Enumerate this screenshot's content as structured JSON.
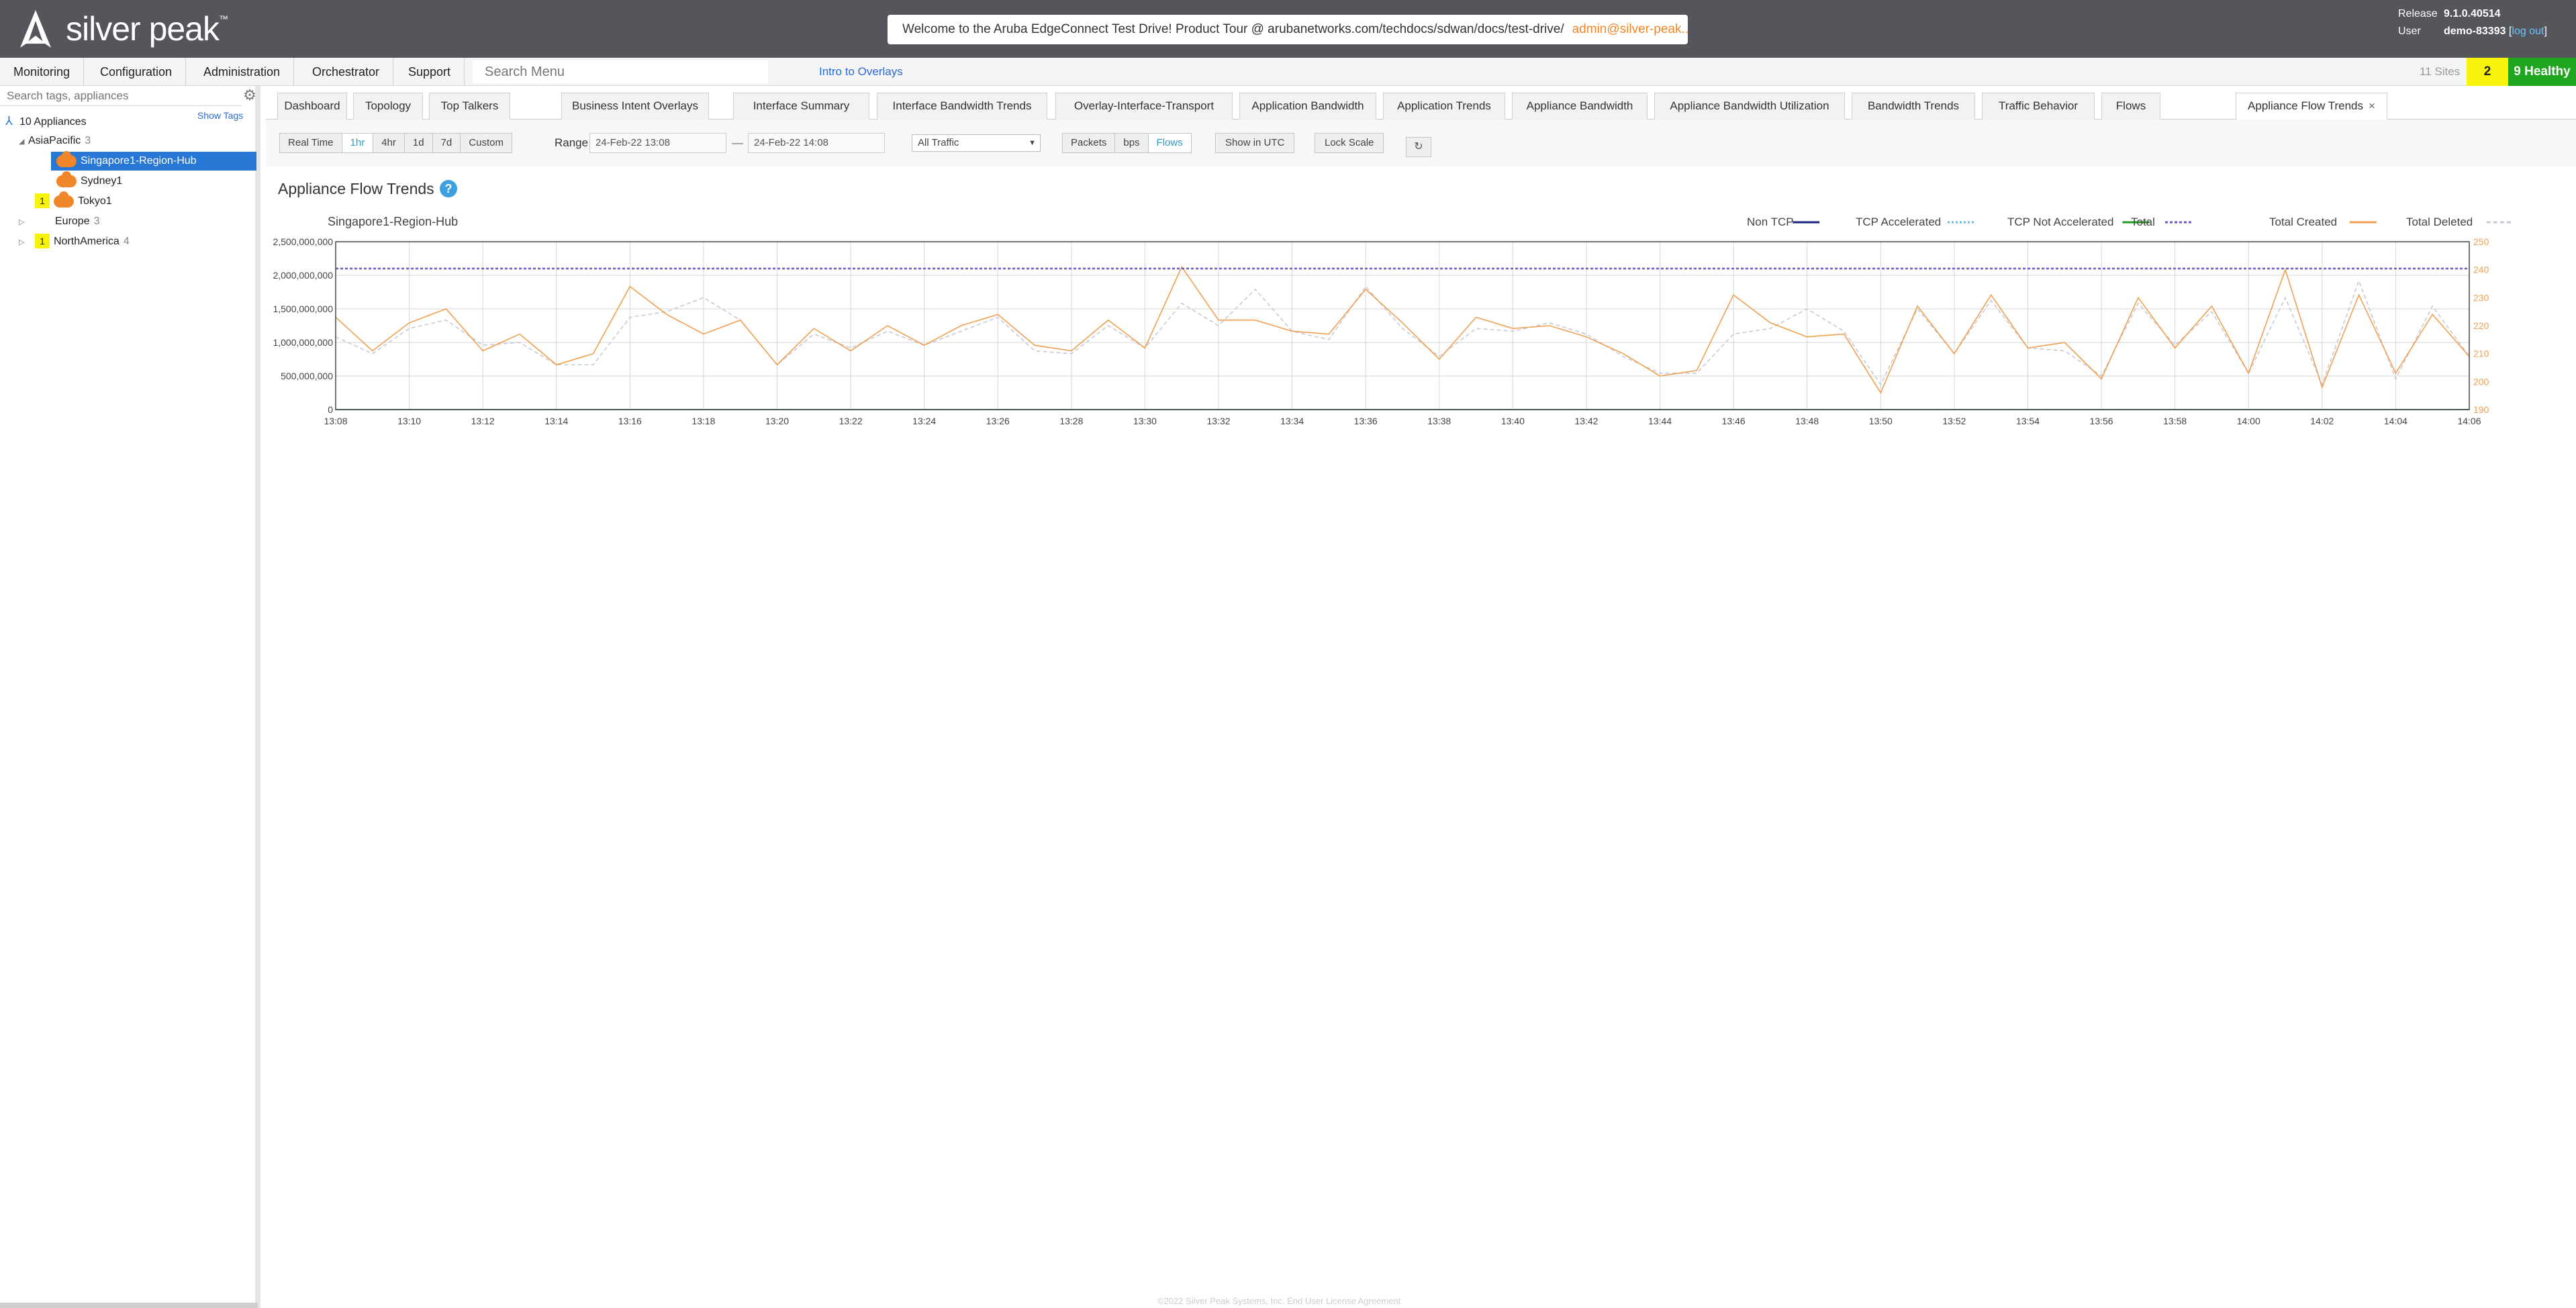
{
  "header": {
    "logo_text": "silver peak",
    "logo_tm": "™",
    "welcome": "Welcome to the Aruba EdgeConnect Test Drive! Product Tour @ arubanetworks.com/techdocs/sdwan/docs/test-drive/",
    "welcome_user": "admin@silver-peak....",
    "release_label": "Release",
    "release_value": "9.1.0.40514",
    "user_label": "User",
    "user_value": "demo-83393",
    "logout_label": "log out"
  },
  "menu": {
    "items": [
      "Monitoring",
      "Configuration",
      "Administration",
      "Orchestrator",
      "Support"
    ],
    "search_placeholder": "Search Menu",
    "intro_link": "Intro to Overlays",
    "sites": "11 Sites",
    "warning_count": "2",
    "healthy": "9 Healthy"
  },
  "sidebar": {
    "search_placeholder": "Search tags, appliances",
    "show_tags": "Show Tags",
    "root": "10 Appliances",
    "groups": [
      {
        "name": "AsiaPacific",
        "count": "3"
      },
      {
        "name": "Europe",
        "count": "3"
      },
      {
        "name": "NorthAmerica",
        "count": "4",
        "alarm": "1"
      }
    ],
    "appliances": [
      {
        "name": "Singapore1-Region-Hub",
        "selected": true
      },
      {
        "name": "Sydney1"
      },
      {
        "name": "Tokyo1",
        "alarm": "1"
      }
    ]
  },
  "tabs": [
    "Dashboard",
    "Topology",
    "Top Talkers",
    "Business Intent Overlays",
    "Interface Summary",
    "Interface Bandwidth Trends",
    "Overlay-Interface-Transport",
    "Application Bandwidth",
    "Application Trends",
    "Appliance Bandwidth",
    "Appliance Bandwidth Utilization",
    "Bandwidth Trends",
    "Traffic Behavior",
    "Flows",
    "Appliance Flow Trends"
  ],
  "tab_close": "×",
  "toolbar": {
    "time_buttons": [
      "Real Time",
      "1hr",
      "4hr",
      "1d",
      "7d",
      "Custom"
    ],
    "time_selected": "1hr",
    "range_label": "Range",
    "range_start": "24-Feb-22 13:08",
    "range_dash": "—",
    "range_end": "24-Feb-22 14:08",
    "traffic_filter": "All Traffic",
    "unit_buttons": [
      "Packets",
      "bps",
      "Flows"
    ],
    "unit_selected": "Flows",
    "utc_button": "Show in UTC",
    "lock_button": "Lock Scale",
    "refresh_icon": "refresh-icon"
  },
  "page": {
    "title": "Appliance Flow Trends",
    "help": "?"
  },
  "chart_data": {
    "type": "line",
    "title": "Singapore1-Region-Hub",
    "x": [
      "13:08",
      "13:09",
      "13:10",
      "13:11",
      "13:12",
      "13:13",
      "13:14",
      "13:15",
      "13:16",
      "13:17",
      "13:18",
      "13:19",
      "13:20",
      "13:21",
      "13:22",
      "13:23",
      "13:24",
      "13:25",
      "13:26",
      "13:27",
      "13:28",
      "13:29",
      "13:30",
      "13:31",
      "13:32",
      "13:33",
      "13:34",
      "13:35",
      "13:36",
      "13:37",
      "13:38",
      "13:39",
      "13:40",
      "13:41",
      "13:42",
      "13:43",
      "13:44",
      "13:45",
      "13:46",
      "13:47",
      "13:48",
      "13:49",
      "13:50",
      "13:51",
      "13:52",
      "13:53",
      "13:54",
      "13:55",
      "13:56",
      "13:57",
      "13:58",
      "13:59",
      "14:00",
      "14:01",
      "14:02",
      "14:03",
      "14:04",
      "14:05",
      "14:06"
    ],
    "x_tick_labels": [
      "13:08",
      "13:10",
      "13:12",
      "13:14",
      "13:16",
      "13:18",
      "13:20",
      "13:22",
      "13:24",
      "13:26",
      "13:28",
      "13:30",
      "13:32",
      "13:34",
      "13:36",
      "13:38",
      "13:40",
      "13:42",
      "13:44",
      "13:46",
      "13:48",
      "13:50",
      "13:52",
      "13:54",
      "13:56",
      "13:58",
      "14:00",
      "14:02",
      "14:04",
      "14:06"
    ],
    "y_left_ticks": [
      "0",
      "500,000,000",
      "1,000,000,000",
      "1,500,000,000",
      "2,000,000,000",
      "2,500,000,000"
    ],
    "y_left_lim": [
      0,
      2500000000
    ],
    "y_right_ticks": [
      "190",
      "200",
      "210",
      "220",
      "230",
      "240",
      "250"
    ],
    "y_right_lim": [
      190,
      250
    ],
    "grid": true,
    "legend_position": "top-right",
    "legend": [
      "Non TCP",
      "TCP Accelerated",
      "TCP Not Accelerated",
      "Total",
      "Total Created",
      "Total Deleted"
    ],
    "colors": {
      "Non TCP": "#1a237e",
      "TCP Accelerated": "#4fc3f7",
      "TCP Not Accelerated": "#1e9b1e",
      "Total": "#6a5acd",
      "Total Created": "#f0a050",
      "Total Deleted": "#c8c8d8"
    },
    "series": [
      {
        "name": "Non TCP",
        "axis": "left",
        "values": [
          0,
          0,
          0,
          0,
          0,
          0,
          0,
          0,
          0,
          0,
          0,
          0,
          0,
          0,
          0,
          0,
          0,
          0,
          0,
          0,
          0,
          0,
          0,
          0,
          0,
          0,
          0,
          0,
          0,
          0,
          0,
          0,
          0,
          0,
          0,
          0,
          0,
          0,
          0,
          0,
          0,
          0,
          0,
          0,
          0,
          0,
          0,
          0,
          0,
          0,
          0,
          0,
          0,
          0,
          0,
          0,
          0,
          0,
          0
        ]
      },
      {
        "name": "TCP Accelerated",
        "axis": "left",
        "values": [
          0,
          0,
          0,
          0,
          0,
          0,
          0,
          0,
          0,
          0,
          0,
          0,
          0,
          0,
          0,
          0,
          0,
          0,
          0,
          0,
          0,
          0,
          0,
          0,
          0,
          0,
          0,
          0,
          0,
          0,
          0,
          0,
          0,
          0,
          0,
          0,
          0,
          0,
          0,
          0,
          0,
          0,
          0,
          0,
          0,
          0,
          0,
          0,
          0,
          0,
          0,
          0,
          0,
          0,
          0,
          0,
          0,
          0,
          0
        ]
      },
      {
        "name": "TCP Not Accelerated",
        "axis": "left",
        "values": [
          0,
          0,
          0,
          0,
          0,
          0,
          0,
          0,
          0,
          0,
          0,
          0,
          0,
          0,
          0,
          0,
          0,
          0,
          0,
          0,
          0,
          0,
          0,
          0,
          0,
          0,
          0,
          0,
          0,
          0,
          0,
          0,
          0,
          0,
          0,
          0,
          0,
          0,
          0,
          0,
          0,
          0,
          0,
          0,
          0,
          0,
          0,
          0,
          0,
          0,
          0,
          0,
          0,
          0,
          0,
          0,
          0,
          0,
          0
        ]
      },
      {
        "name": "Total",
        "axis": "left",
        "values": [
          2100000000,
          2100000000,
          2100000000,
          2100000000,
          2100000000,
          2100000000,
          2100000000,
          2100000000,
          2100000000,
          2100000000,
          2100000000,
          2100000000,
          2100000000,
          2100000000,
          2100000000,
          2100000000,
          2100000000,
          2100000000,
          2100000000,
          2100000000,
          2100000000,
          2100000000,
          2100000000,
          2100000000,
          2100000000,
          2100000000,
          2100000000,
          2100000000,
          2100000000,
          2100000000,
          2100000000,
          2100000000,
          2100000000,
          2100000000,
          2100000000,
          2100000000,
          2100000000,
          2100000000,
          2100000000,
          2100000000,
          2100000000,
          2100000000,
          2100000000,
          2100000000,
          2100000000,
          2100000000,
          2100000000,
          2100000000,
          2100000000,
          2100000000,
          2100000000,
          2100000000,
          2100000000,
          2100000000,
          2100000000,
          2100000000,
          2100000000,
          2100000000,
          2100000000
        ]
      },
      {
        "name": "Total Created",
        "axis": "right",
        "values": [
          223,
          211,
          221,
          226,
          211,
          217,
          206,
          210,
          234,
          224,
          217,
          222,
          206,
          219,
          211,
          220,
          213,
          220,
          224,
          213,
          211,
          222,
          212,
          241,
          222,
          222,
          218,
          217,
          233,
          221,
          208,
          223,
          219,
          220,
          216,
          210,
          202,
          204,
          231,
          221,
          216,
          217,
          196,
          227,
          210,
          231,
          212,
          214,
          201,
          230,
          212,
          227,
          203,
          240,
          198,
          231,
          203,
          224,
          209
        ]
      },
      {
        "name": "Total Deleted",
        "axis": "right",
        "values": [
          216,
          210,
          219,
          222,
          213,
          214,
          206,
          206,
          223,
          225,
          230,
          222,
          206,
          217,
          212,
          218,
          213,
          218,
          223,
          211,
          210,
          220,
          212,
          228,
          220,
          233,
          218,
          215,
          234,
          219,
          209,
          219,
          218,
          221,
          217,
          209,
          203,
          203,
          217,
          219,
          226,
          218,
          199,
          226,
          210,
          229,
          212,
          211,
          202,
          228,
          213,
          225,
          203,
          230,
          199,
          236,
          201,
          227,
          209
        ]
      }
    ]
  },
  "footer": {
    "copyright": "©2022 Silver Peak Systems, Inc.",
    "eula": "End User License Agreement"
  }
}
